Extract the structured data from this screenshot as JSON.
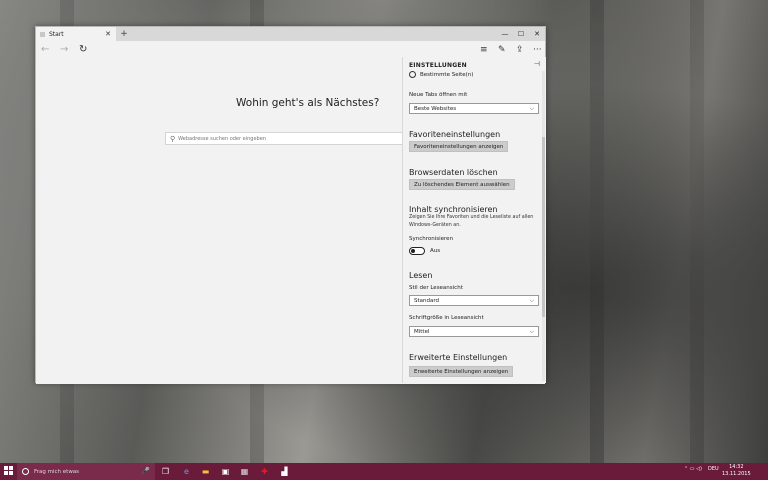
{
  "browser": {
    "tab_title": "Start",
    "new_tab": "+",
    "controls": {
      "minimize": "—",
      "maximize": "☐",
      "close": "✕"
    },
    "tab_close": "✕"
  },
  "nav": {
    "back": "←",
    "forward": "→",
    "reload": "↻",
    "hub": "≡",
    "note": "✎",
    "share": "⇪",
    "more": "···"
  },
  "start_page": {
    "headline": "Wohin geht's als Nächstes?",
    "search_placeholder": "Webadresse suchen oder eingeben"
  },
  "settings": {
    "title": "EINSTELLUNGEN",
    "pin": "⊣",
    "open_with_option": "Bestimmte Seite(n)",
    "new_tabs_label": "Neue Tabs öffnen mit",
    "new_tabs_value": "Beste Websites",
    "favorites_heading": "Favoriteneinstellungen",
    "favorites_button": "Favoriteneinstellungen anzeigen",
    "clear_heading": "Browserdaten löschen",
    "clear_button": "Zu löschendes Element auswählen",
    "sync_heading": "Inhalt synchronisieren",
    "sync_desc": "Zeigen Sie Ihre Favoriten und die Leseliste auf allen Windows-Geräten an.",
    "sync_label": "Synchronisieren",
    "sync_state": "Aus",
    "read_heading": "Lesen",
    "read_style_label": "Stil der Leseansicht",
    "read_style_value": "Standard",
    "read_font_label": "Schriftgröße in Leseansicht",
    "read_font_value": "Mittel",
    "advanced_heading": "Erweiterte Einstellungen",
    "advanced_button": "Erweiterte Einstellungen anzeigen",
    "chevron": "⌵"
  },
  "taskbar": {
    "search_placeholder": "Frag mich etwas",
    "mic": "🎤",
    "tray_lang": "DEU",
    "time": "14:32",
    "date": "13.11.2015",
    "tray_icons": "⌃ ▭ ◁)"
  },
  "colors": {
    "taskbar": "#6a1b3a",
    "window_bg": "#f2f2f2",
    "button": "#cccccc"
  }
}
